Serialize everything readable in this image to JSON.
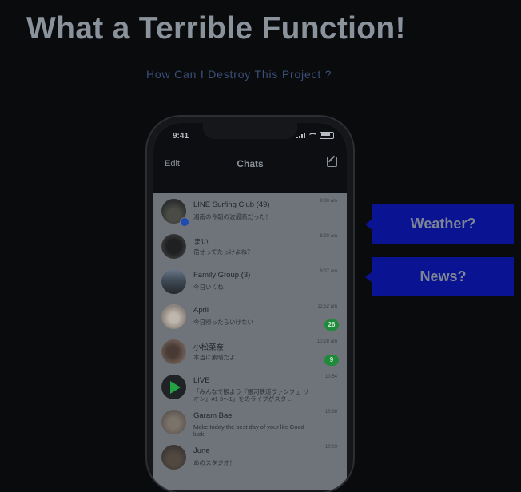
{
  "slide": {
    "title": "What a Terrible Function!",
    "subtitle": "How Can I Destroy This Project ?"
  },
  "phone": {
    "status_time": "9:41",
    "header": {
      "edit_label": "Edit",
      "title": "Chats",
      "compose_icon": "compose-icon"
    },
    "chats": [
      {
        "name": "LINE Surfing Club (49)",
        "preview": "湘南の今朝の波最高だった！",
        "time": "9:00 am",
        "badge": "",
        "verified": true,
        "icon": "avatar"
      },
      {
        "name": "まい",
        "preview": "宿せってたっけよね？",
        "time": "8:20 am",
        "badge": "",
        "verified": false,
        "icon": "avatar"
      },
      {
        "name": "Family Group (3)",
        "preview": "今日いくね",
        "time": "8:07 am",
        "badge": "",
        "verified": false,
        "icon": "avatar"
      },
      {
        "name": "April",
        "preview": "今日帰ったらいけない",
        "time": "11:52 am",
        "badge": "26",
        "verified": false,
        "icon": "avatar"
      },
      {
        "name": "小松菜奈",
        "preview": "本当に素晴だよ！",
        "time": "10:28 am",
        "badge": "9",
        "verified": false,
        "icon": "avatar"
      },
      {
        "name": "LIVE",
        "preview": "「みんなで観よう『銀河鉄道ヴァンフェ リオン』#1 3〜1」をのライブがスタ ...",
        "time": "10:54",
        "badge": "",
        "verified": false,
        "icon": "play-icon"
      },
      {
        "name": "Garam Bae",
        "preview": "Make today the best day of your life Good luck!",
        "time": "10:08",
        "badge": "",
        "verified": false,
        "icon": "avatar"
      },
      {
        "name": "June",
        "preview": "あのスタジオ！",
        "time": "10:03",
        "badge": "",
        "verified": false,
        "icon": "avatar"
      }
    ]
  },
  "callouts": [
    {
      "label": "Weather?"
    },
    {
      "label": "News?"
    }
  ],
  "colors": {
    "background": "#0a0b0d",
    "title": "#8a929c",
    "subtitle": "#3a4f7a",
    "callout": "#0a1392",
    "badge": "#1f8a3a"
  }
}
